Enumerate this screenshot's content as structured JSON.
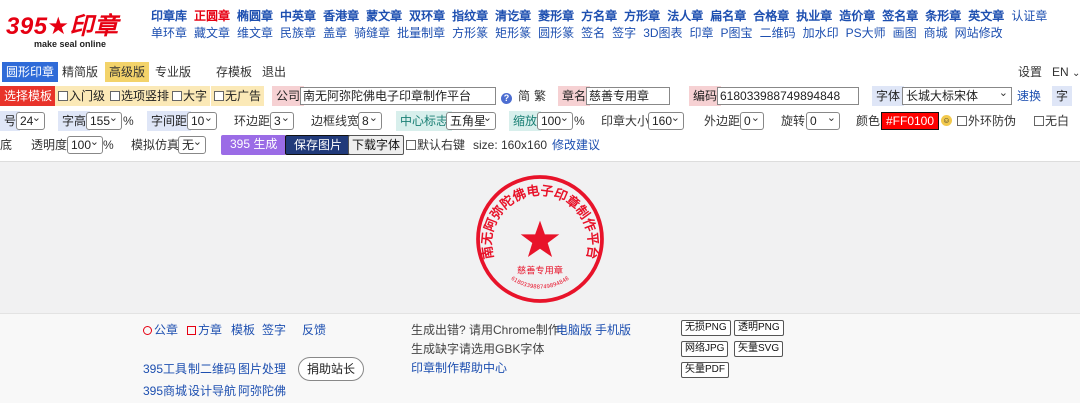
{
  "logo": {
    "brand": "395★印章",
    "tagline": "make seal online"
  },
  "nav": {
    "row1": [
      "印章库",
      "正圆章",
      "椭圆章",
      "中英章",
      "香港章",
      "蒙文章",
      "双环章",
      "指纹章",
      "清讫章",
      "菱形章",
      "方名章",
      "方形章",
      "法人章",
      "扁名章",
      "合格章",
      "执业章",
      "造价章",
      "签名章",
      "条形章",
      "英文章",
      "认证章"
    ],
    "row2": [
      "单环章",
      "藏文章",
      "维文章",
      "民族章",
      "盖章",
      "骑缝章",
      "批量制章",
      "方形篆",
      "矩形篆",
      "圆形篆",
      "签名",
      "签字",
      "3D图表",
      "印章",
      "P图宝",
      "二维码",
      "加水印",
      "PS大师",
      "画图",
      "商城",
      "网站修改"
    ]
  },
  "tabs": {
    "circle_seal": "圆形印章",
    "simple": "精简版",
    "advanced": "高级版",
    "pro": "专业版",
    "template_storage": "存模板",
    "logout": "退出",
    "settings": "设置",
    "language": "EN"
  },
  "options": {
    "choose_template": "选择模板",
    "entry_level": "入门级",
    "vertical_options": "选项竖排",
    "large_font": "大字",
    "no_ads": "无广告",
    "company_label": "公司",
    "company_value": "南无阿弥陀佛电子印章制作平台",
    "simplified": "简",
    "traditional": "繁",
    "seal_name_label": "章名",
    "seal_name_value": "慈善专用章",
    "code_label": "编码",
    "code_value": "618033988749894848",
    "font_label": "体",
    "font_partial": "字",
    "font_value": "长城大标宋体",
    "quick_change": "速换",
    "font_size_edge": "字"
  },
  "params": {
    "size_edge": "号",
    "size_value": "24",
    "char_height_label": "字高",
    "char_height_value": "155",
    "percent": "%",
    "char_spacing_label": "字间距",
    "char_spacing_value": "10",
    "ring_spacing_label": "环边距",
    "ring_spacing_value": "3",
    "border_width_label": "边框线宽",
    "border_width_value": "8",
    "center_mark_label": "中心标志",
    "center_mark_value": "五角星",
    "zoom_label": "缩放",
    "zoom_value": "100",
    "seal_size_label": "印章大小",
    "seal_size_value": "160",
    "outer_margin_label": "外边距",
    "outer_margin_value": "0",
    "rotate_label": "旋转",
    "rotate_value": "0",
    "color_label": "颜色",
    "color_value": "#FF0100",
    "no_outer_ring": "外环防伪",
    "no_white": "无白"
  },
  "actions": {
    "bottom_edge": "底",
    "opacity_label": "透明度",
    "opacity_value": "100",
    "percent": "%",
    "simulation_label": "模拟仿真",
    "simulation_value": "无",
    "generate": "395 生成",
    "save_image": "保存图片",
    "download_font": "下载字体",
    "default_right_click": "默认右键",
    "size_text": "size: 160x160",
    "feedback": "修改建议"
  },
  "seal": {
    "company_text": "南无阿弥陀佛电子印章制作平台",
    "name_text": "慈善专用章",
    "code_text": "618033988749894848",
    "color": "#e8132a"
  },
  "footer": {
    "public_seal": "公章",
    "square_seal": "方章",
    "template": "模板",
    "signature": "签字",
    "feedback": "反馈",
    "tools": "395工具",
    "qrcode": "制二维码",
    "image_process": "图片处理",
    "shop": "395商城",
    "design_nav": "设计导航",
    "amitabha": "阿弥陀佛",
    "donate": "捐助站长",
    "error_msg": "生成出错? 请用Chrome制作:",
    "desktop": "电脑版",
    "mobile": "手机版",
    "gbk_msg": "生成缺字请选用GBK字体",
    "help_center": "印章制作帮助中心",
    "lossless_png": "无损PNG",
    "transparent_png": "透明PNG",
    "web_jpg": "网络JPG",
    "vector_svg": "矢量SVG",
    "vector_pdf": "矢量PDF"
  },
  "colors": {
    "brand_red": "#e60012",
    "link_blue": "#1d4fb0",
    "accent_purple": "#9b6ce6",
    "navy": "#213a7a"
  }
}
